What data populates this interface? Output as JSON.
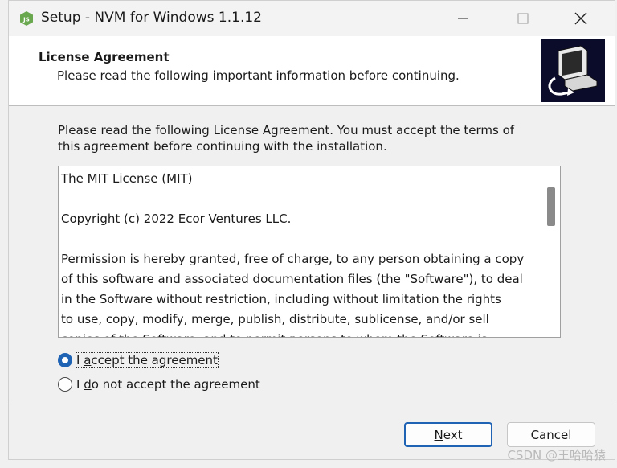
{
  "window": {
    "title": "Setup - NVM for Windows 1.1.12",
    "controls": {
      "minimize": "minimize-icon",
      "maximize": "maximize-icon",
      "close": "close-icon"
    }
  },
  "header": {
    "title": "License Agreement",
    "subtitle": "Please read the following important information before continuing."
  },
  "intro_text": "Please read the following License Agreement. You must accept the terms of this agreement before continuing with the installation.",
  "license": {
    "lines": [
      "The MIT License (MIT)",
      "",
      "Copyright (c) 2022 Ecor Ventures LLC.",
      "",
      "Permission is hereby granted, free of charge, to any person obtaining a copy",
      "of this software and associated documentation files (the \"Software\"), to deal",
      "in the Software without restriction, including without limitation the rights",
      "to use, copy, modify, merge, publish, distribute, sublicense, and/or sell",
      "copies of the Software, and to permit persons to whom the Software is"
    ]
  },
  "options": {
    "accept": {
      "prefix": "I ",
      "hotkey": "a",
      "rest": "ccept the agreement",
      "selected": true
    },
    "decline": {
      "prefix": "I ",
      "hotkey": "d",
      "rest": "o not accept the agreement",
      "selected": false
    }
  },
  "buttons": {
    "next": {
      "hotkey": "N",
      "rest": "ext"
    },
    "cancel": "Cancel"
  },
  "watermark": "CSDN @王哈哈猿",
  "colors": {
    "accent": "#1f63b5",
    "header_bg": "#ffffff",
    "dialog_bg": "#f0f0f0"
  }
}
